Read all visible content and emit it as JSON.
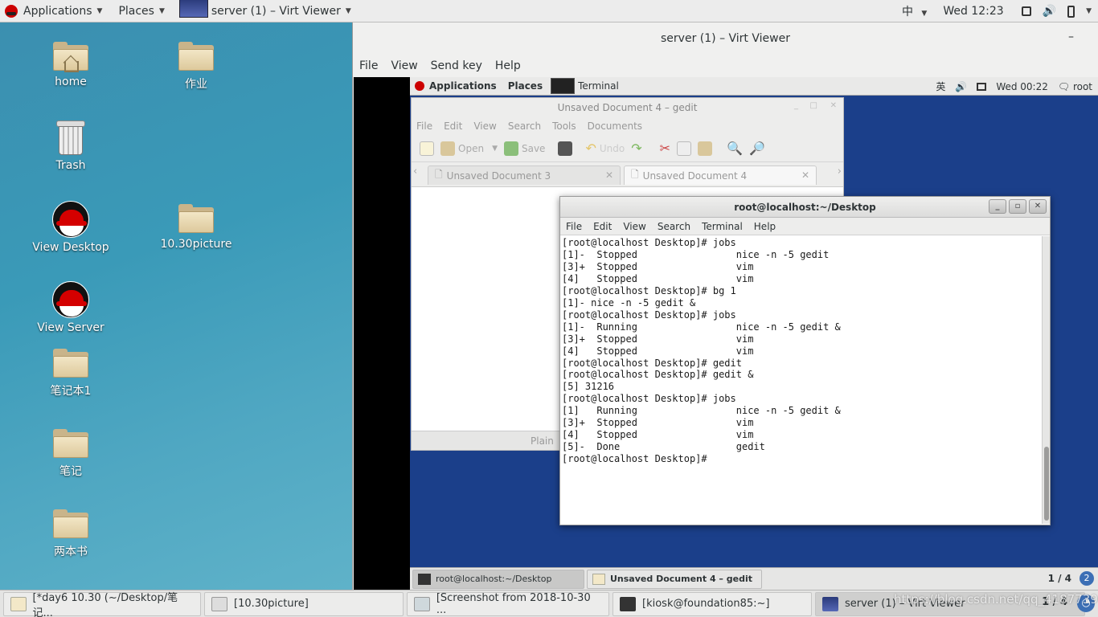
{
  "host_topbar": {
    "applications": "Applications",
    "places": "Places",
    "window_title": "server (1) – Virt Viewer",
    "input_method": "中",
    "clock": "Wed 12:23"
  },
  "desktop_icons": [
    {
      "label": "home"
    },
    {
      "label": "作业"
    },
    {
      "label": "Trash"
    },
    {
      "label": "View Desktop"
    },
    {
      "label": "10.30picture"
    },
    {
      "label": "View Server"
    },
    {
      "label": "笔记本1"
    },
    {
      "label": "笔记"
    },
    {
      "label": "两本书"
    }
  ],
  "virt_viewer": {
    "title": "server (1) – Virt Viewer",
    "minimize": "–",
    "menu": [
      "File",
      "View",
      "Send key",
      "Help"
    ]
  },
  "guest_topbar": {
    "applications": "Applications",
    "places": "Places",
    "terminal": "Terminal",
    "input_method": "英",
    "clock": "Wed 00:22",
    "user": "root"
  },
  "gedit": {
    "title": "Unsaved Document 4 – gedit",
    "menu": [
      "File",
      "Edit",
      "View",
      "Search",
      "Tools",
      "Documents"
    ],
    "toolbar": {
      "open": "Open",
      "save": "Save",
      "undo": "Undo"
    },
    "tabs": [
      "Unsaved Document 3",
      "Unsaved Document 4"
    ],
    "status": "Plain"
  },
  "terminal": {
    "title": "root@localhost:~/Desktop",
    "menu": [
      "File",
      "Edit",
      "View",
      "Search",
      "Terminal",
      "Help"
    ],
    "lines": [
      "[root@localhost Desktop]# jobs",
      "[1]-  Stopped                 nice -n -5 gedit",
      "[3]+  Stopped                 vim",
      "[4]   Stopped                 vim",
      "[root@localhost Desktop]# bg 1",
      "[1]- nice -n -5 gedit &",
      "[root@localhost Desktop]# jobs",
      "[1]-  Running                 nice -n -5 gedit &",
      "[3]+  Stopped                 vim",
      "[4]   Stopped                 vim",
      "[root@localhost Desktop]# gedit",
      "[root@localhost Desktop]# gedit &",
      "[5] 31216",
      "[root@localhost Desktop]# jobs",
      "[1]   Running                 nice -n -5 gedit &",
      "[3]+  Stopped                 vim",
      "[4]   Stopped                 vim",
      "[5]-  Done                    gedit",
      "[root@localhost Desktop]#"
    ]
  },
  "guest_taskbar": {
    "tasks": [
      "root@localhost:~/Desktop",
      "Unsaved Document 4 – gedit"
    ],
    "page": "1 / 4",
    "workspace_icon": "2"
  },
  "host_taskbar": {
    "tasks": [
      "[*day6 10.30 (~/Desktop/笔记...",
      "[10.30picture]",
      "[Screenshot from 2018-10-30 ...",
      "[kiosk@foundation85:~]",
      "server (1) – Virt Viewer"
    ],
    "page": "1 / 4",
    "watermark": "https://blog.csdn.net/qq_41877390"
  }
}
